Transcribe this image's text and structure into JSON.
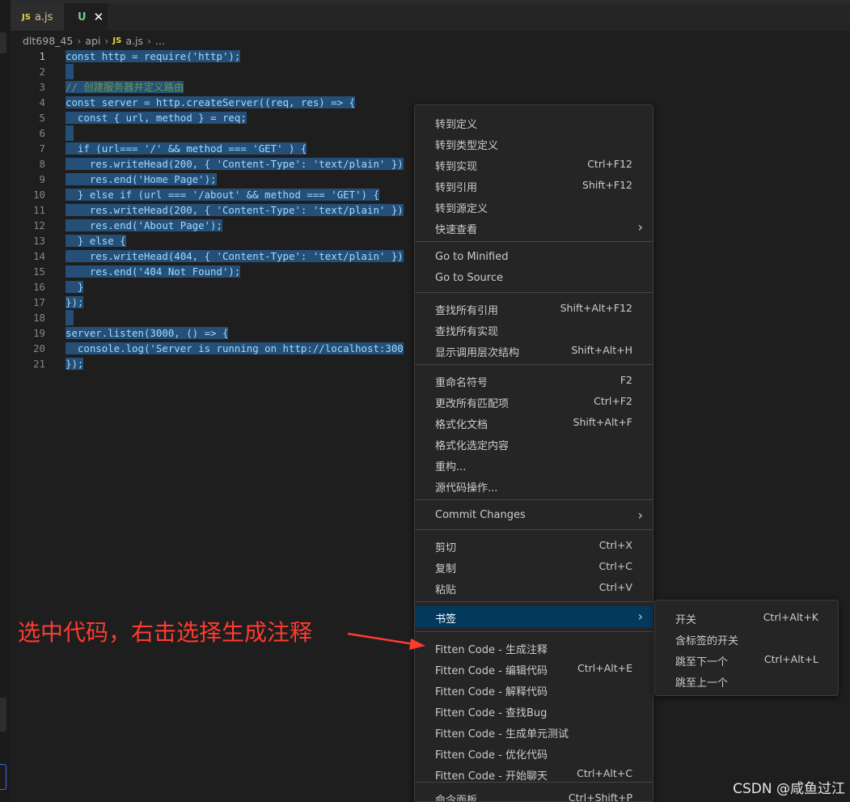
{
  "tabs": [
    {
      "icon": "JS",
      "label": "a.js"
    },
    {
      "icon": "U",
      "close": "✕"
    }
  ],
  "breadcrumb": [
    "dlt698_45",
    "api",
    "JS",
    "a.js",
    "..."
  ],
  "colors": {
    "selection": "#264f78",
    "accent": "#04395e",
    "annotation": "#ff3b30"
  },
  "code": [
    {
      "ln": "1",
      "text": "const http = require('http');"
    },
    {
      "ln": "2",
      "text": ""
    },
    {
      "ln": "3",
      "text": "// 创建服务器并定义路由"
    },
    {
      "ln": "4",
      "text": "const server = http.createServer((req, res) => {"
    },
    {
      "ln": "5",
      "text": "  const { url, method } = req;"
    },
    {
      "ln": "6",
      "text": ""
    },
    {
      "ln": "7",
      "text": "  if (url=== '/' && method === 'GET' ) {"
    },
    {
      "ln": "8",
      "text": "    res.writeHead(200, { 'Content-Type': 'text/plain' })"
    },
    {
      "ln": "9",
      "text": "    res.end('Home Page');"
    },
    {
      "ln": "10",
      "text": "  } else if (url === '/about' && method === 'GET') {"
    },
    {
      "ln": "11",
      "text": "    res.writeHead(200, { 'Content-Type': 'text/plain' })"
    },
    {
      "ln": "12",
      "text": "    res.end('About Page');"
    },
    {
      "ln": "13",
      "text": "  } else {"
    },
    {
      "ln": "14",
      "text": "    res.writeHead(404, { 'Content-Type': 'text/plain' })"
    },
    {
      "ln": "15",
      "text": "    res.end('404 Not Found');"
    },
    {
      "ln": "16",
      "text": "  }"
    },
    {
      "ln": "17",
      "text": "});"
    },
    {
      "ln": "18",
      "text": ""
    },
    {
      "ln": "19",
      "text": "server.listen(3000, () => {"
    },
    {
      "ln": "20",
      "text": "  console.log('Server is running on http://localhost:300"
    },
    {
      "ln": "21",
      "text": "});"
    }
  ],
  "menu": [
    {
      "label": "转到定义",
      "kb": ""
    },
    {
      "label": "转到类型定义",
      "kb": ""
    },
    {
      "label": "转到实现",
      "kb": "Ctrl+F12"
    },
    {
      "label": "转到引用",
      "kb": "Shift+F12"
    },
    {
      "label": "转到源定义",
      "kb": ""
    },
    {
      "label": "快速查看",
      "kb": "",
      "chev": "›"
    },
    {
      "label": "Go to Minified",
      "kb": ""
    },
    {
      "label": "Go to Source",
      "kb": ""
    },
    {
      "label": "查找所有引用",
      "kb": "Shift+Alt+F12"
    },
    {
      "label": "查找所有实现",
      "kb": ""
    },
    {
      "label": "显示调用层次结构",
      "kb": "Shift+Alt+H"
    },
    {
      "label": "重命名符号",
      "kb": "F2"
    },
    {
      "label": "更改所有匹配项",
      "kb": "Ctrl+F2"
    },
    {
      "label": "格式化文档",
      "kb": "Shift+Alt+F"
    },
    {
      "label": "格式化选定内容",
      "kb": ""
    },
    {
      "label": "重构...",
      "kb": ""
    },
    {
      "label": "源代码操作...",
      "kb": ""
    },
    {
      "label": "Commit Changes",
      "kb": "",
      "chev": "›"
    },
    {
      "label": "剪切",
      "kb": "Ctrl+X"
    },
    {
      "label": "复制",
      "kb": "Ctrl+C"
    },
    {
      "label": "粘贴",
      "kb": "Ctrl+V"
    },
    {
      "label": "书签",
      "kb": "",
      "chev": "›"
    },
    {
      "label": "Fitten Code - 生成注释",
      "kb": ""
    },
    {
      "label": "Fitten Code - 编辑代码",
      "kb": "Ctrl+Alt+E"
    },
    {
      "label": "Fitten Code - 解释代码",
      "kb": ""
    },
    {
      "label": "Fitten Code - 查找Bug",
      "kb": ""
    },
    {
      "label": "Fitten Code - 生成单元测试",
      "kb": ""
    },
    {
      "label": "Fitten Code - 优化代码",
      "kb": ""
    },
    {
      "label": "Fitten Code - 开始聊天",
      "kb": "Ctrl+Alt+C"
    },
    {
      "label": "命令面板...",
      "kb": "Ctrl+Shift+P"
    }
  ],
  "submenu": [
    {
      "label": "开关",
      "kb": "Ctrl+Alt+K"
    },
    {
      "label": "含标签的开关",
      "kb": ""
    },
    {
      "label": "跳至下一个",
      "kb": "Ctrl+Alt+L"
    },
    {
      "label": "跳至上一个",
      "kb": ""
    }
  ],
  "annotation": "选中代码，右击选择生成注释",
  "watermark": "CSDN @咸鱼过江"
}
